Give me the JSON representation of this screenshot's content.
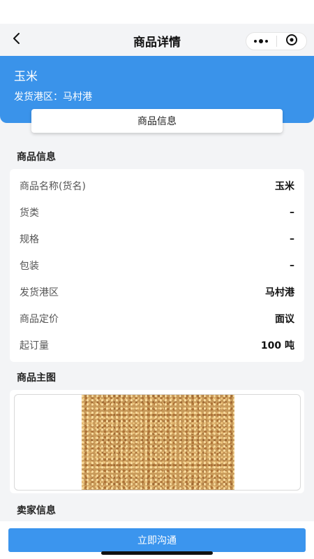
{
  "nav": {
    "title": "商品详情",
    "back_icon": "chevron-left-icon",
    "more_icon": "more-dots-icon",
    "close_icon": "target-close-icon"
  },
  "hero": {
    "product_name": "玉米",
    "port_line": "发货港区：马村港",
    "color": "#3a93ea"
  },
  "tab": {
    "label": "商品信息"
  },
  "info_section": {
    "title": "商品信息",
    "rows": [
      {
        "label": "商品名称(货名)",
        "value": "玉米"
      },
      {
        "label": "货类",
        "value": "–"
      },
      {
        "label": "规格",
        "value": "–"
      },
      {
        "label": "包装",
        "value": "–"
      },
      {
        "label": "发货港区",
        "value": "马村港"
      },
      {
        "label": "商品定价",
        "value": "面议"
      },
      {
        "label": "起订量",
        "value": "100 吨"
      }
    ]
  },
  "image_section": {
    "title": "商品主图"
  },
  "seller_section": {
    "title": "卖家信息"
  },
  "action": {
    "contact_label": "立即沟通",
    "color": "#3b95ee"
  }
}
